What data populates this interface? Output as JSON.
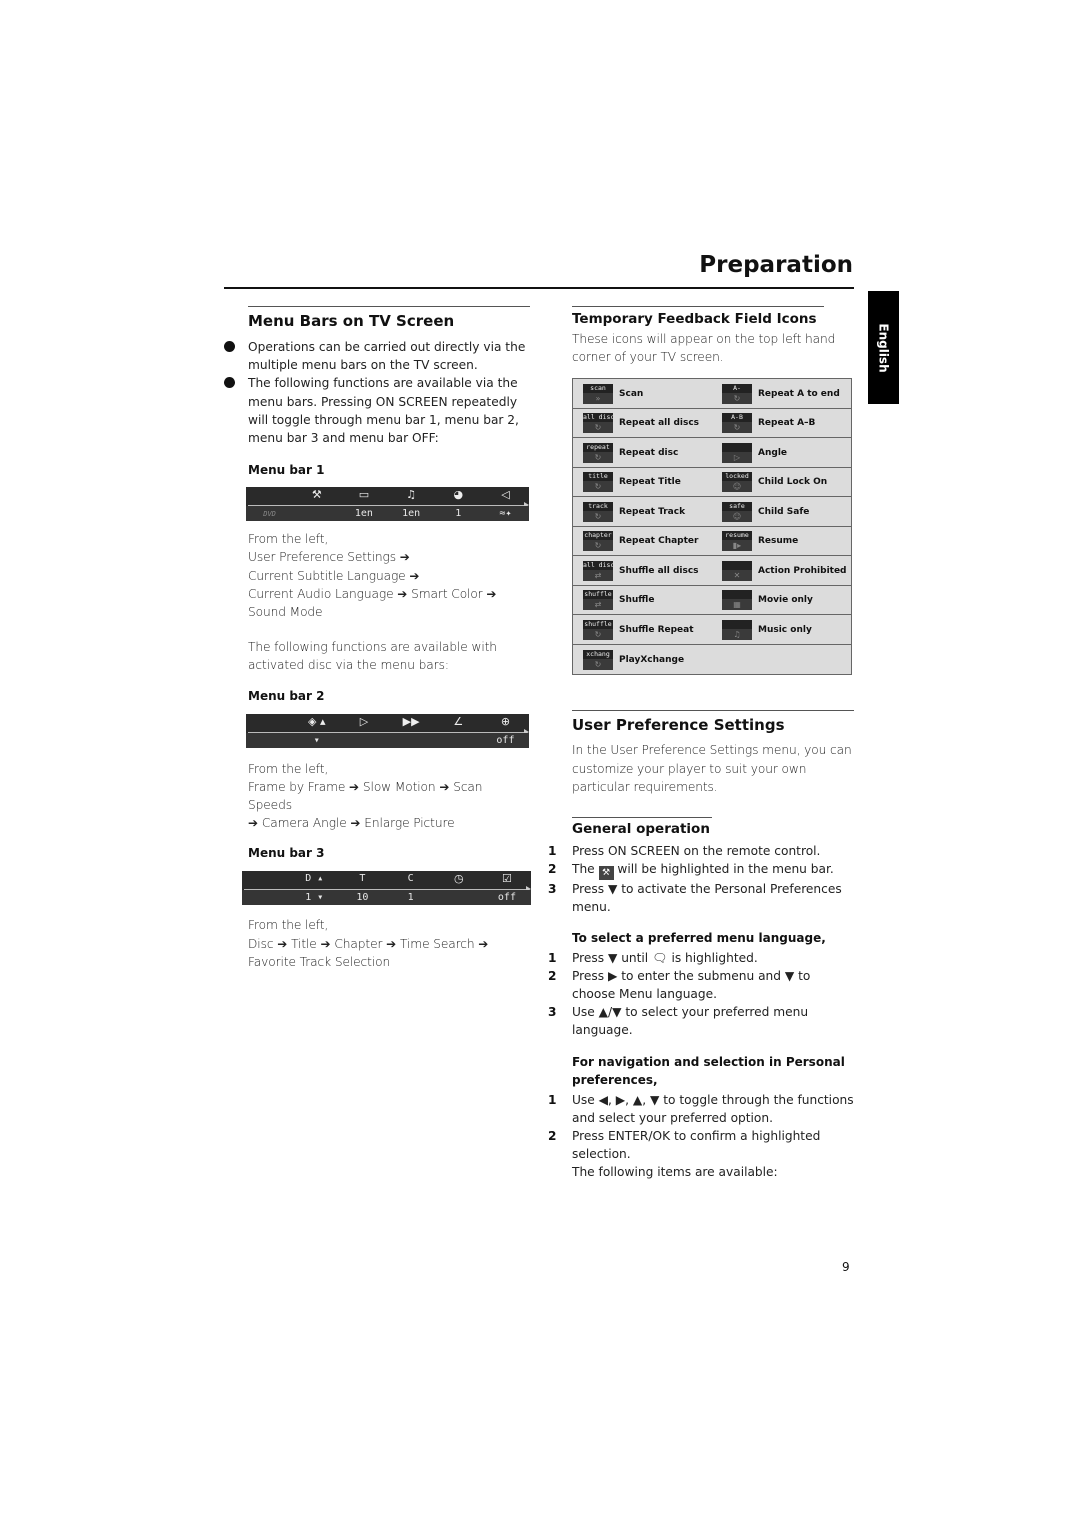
{
  "header": {
    "title": "Preparation",
    "language_tab": "English"
  },
  "left": {
    "heading": "Menu Bars on TV Screen",
    "bullets": [
      "Operations can be carried out directly via the multiple menu bars on the TV screen.",
      "The following functions are available via the menu bars. Pressing ON SCREEN repeatedly will toggle through menu bar 1, menu bar 2, menu bar 3 and menu bar OFF:"
    ],
    "menubar1": {
      "heading": "Menu bar 1",
      "source_label": "DVD",
      "icons": [
        "tools-icon",
        "subtitle-icon",
        "audio-language-icon",
        "smart-color-icon",
        "sound-mode-icon"
      ],
      "values": [
        "",
        "1en",
        "1en",
        "1",
        "≈✦"
      ],
      "desc_lines": [
        "From the left,",
        "User Preference Settings ➔",
        "Current Subtitle Language ➔",
        "Current Audio Language ➔ Smart Color ➔",
        "Sound Mode"
      ]
    },
    "intro2_lines": [
      "The following functions are available with",
      "activated disc via the menu bars:"
    ],
    "menubar2": {
      "heading": "Menu bar 2",
      "icons": [
        "frame-by-frame-icon",
        "slow-motion-icon",
        "scan-speed-icon",
        "camera-angle-icon",
        "zoom-icon"
      ],
      "values": [
        "",
        "",
        "",
        "",
        "off"
      ],
      "desc_lines": [
        "From the left,",
        "Frame by Frame ➔ Slow Motion ➔ Scan Speeds",
        "➔ Camera Angle ➔ Enlarge Picture"
      ]
    },
    "menubar3": {
      "heading": "Menu bar 3",
      "labels": [
        "D",
        "T",
        "C",
        "",
        ""
      ],
      "icons": [
        "disc-icon",
        "title-icon",
        "chapter-icon",
        "time-search-icon",
        "favorite-track-icon"
      ],
      "values": [
        "1",
        "10",
        "1",
        "",
        "off"
      ],
      "desc_lines": [
        "From the left,",
        "Disc ➔ Title ➔ Chapter ➔ Time Search ➔",
        "Favorite Track Selection"
      ]
    }
  },
  "right": {
    "feedback": {
      "heading": "Temporary Feedback Field Icons",
      "intro": "These icons will appear on the top left hand corner of your TV screen.",
      "rows": [
        [
          {
            "tag": "scan",
            "name": "Scan"
          },
          {
            "tag": "A-",
            "name": "Repeat A to end"
          }
        ],
        [
          {
            "tag": "all disc",
            "name": "Repeat all discs"
          },
          {
            "tag": "A-B",
            "name": "Repeat A–B"
          }
        ],
        [
          {
            "tag": "repeat",
            "name": "Repeat disc"
          },
          {
            "tag": "",
            "name": "Angle"
          }
        ],
        [
          {
            "tag": "title",
            "name": "Repeat Title"
          },
          {
            "tag": "locked",
            "name": "Child Lock On"
          }
        ],
        [
          {
            "tag": "track",
            "name": "Repeat Track"
          },
          {
            "tag": "safe",
            "name": "Child Safe"
          }
        ],
        [
          {
            "tag": "chapter",
            "name": "Repeat Chapter"
          },
          {
            "tag": "resume",
            "name": "Resume"
          }
        ],
        [
          {
            "tag": "all disc",
            "name": "Shuffle all discs"
          },
          {
            "tag": "",
            "name": "Action Prohibited"
          }
        ],
        [
          {
            "tag": "shuffle",
            "name": "Shuffle"
          },
          {
            "tag": "",
            "name": "Movie only"
          }
        ],
        [
          {
            "tag": "shuffle",
            "name": "Shuffle Repeat"
          },
          {
            "tag": "",
            "name": "Music only"
          }
        ],
        [
          {
            "tag": "xchang",
            "name": "PlayXchange"
          },
          null
        ]
      ]
    },
    "ups": {
      "heading": "User Preference Settings",
      "intro": "In the User Preference Settings menu, you can customize your player to suit your own particular requirements."
    },
    "general": {
      "heading": "General operation",
      "steps": [
        {
          "num": "1",
          "text": "Press ON SCREEN on the remote control."
        },
        {
          "num": "2",
          "pre": "The",
          "post": "will be highlighted in the menu bar."
        },
        {
          "num": "3",
          "text": "Press ▼ to activate the Personal Preferences menu."
        }
      ],
      "lang_heading": "To select a preferred menu language,",
      "lang_steps": [
        {
          "num": "1",
          "pre": "Press ▼ until",
          "post": "is highlighted."
        },
        {
          "num": "2",
          "text": "Press ▶ to enter the submenu and ▼ to choose Menu language."
        },
        {
          "num": "3",
          "text": "Use ▲/▼ to select your preferred menu language."
        }
      ],
      "nav_heading": "For navigation and selection in Personal preferences,",
      "nav_steps": [
        {
          "num": "1",
          "text": "Use ◀, ▶, ▲, ▼ to toggle through the functions and select your preferred option."
        },
        {
          "num": "2",
          "text": "Press ENTER/OK to confirm a highlighted selection."
        }
      ],
      "closing": "The following items are available:"
    }
  },
  "footer": {
    "page_number": "9"
  }
}
